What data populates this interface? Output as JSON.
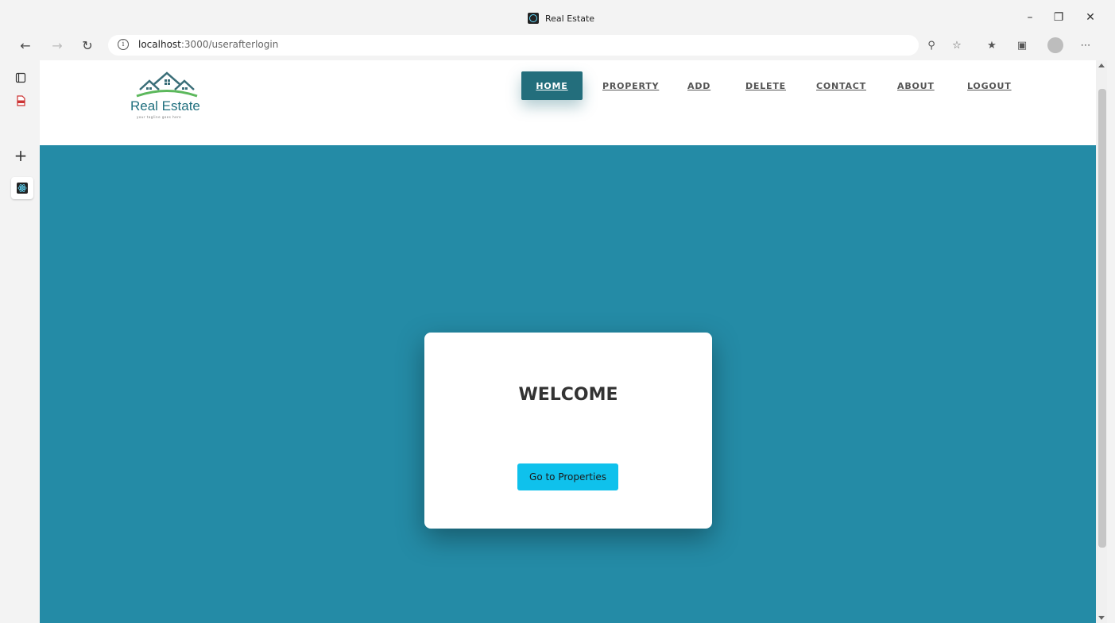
{
  "window": {
    "title": "Real Estate",
    "minimize_icon": "minimize-icon",
    "restore_icon": "restore-icon",
    "close_icon": "close-icon"
  },
  "toolbar": {
    "back_icon": "back-arrow-icon",
    "forward_icon": "forward-arrow-icon",
    "refresh_icon": "refresh-icon",
    "url_host": "localhost",
    "url_path": ":3000/userafterlogin"
  },
  "site": {
    "logo_text": "Real Estate",
    "logo_tagline": "your tagline goes here",
    "menu": [
      "HOME",
      "PROPERTY",
      "ADD",
      "DELETE",
      "CONTACT",
      "ABOUT",
      "LOGOUT"
    ],
    "active_menu": "HOME",
    "brand_color": "#236e7c",
    "background_color": "#248ba6"
  },
  "card": {
    "heading": "WELCOME",
    "button_label": "Go to Properties",
    "button_color": "#0fc1ec"
  }
}
